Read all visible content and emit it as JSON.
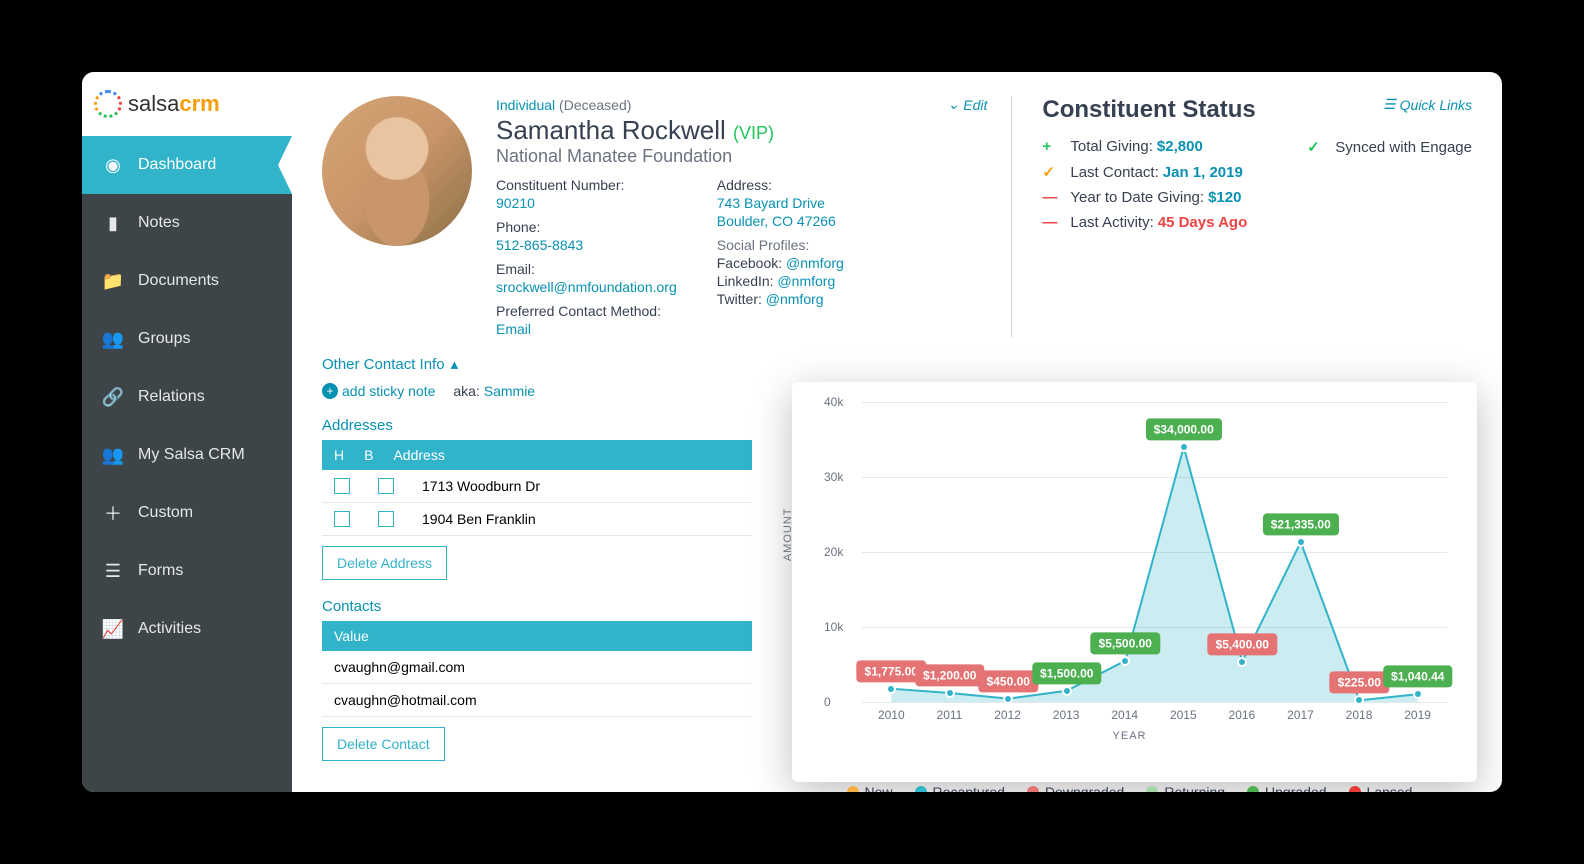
{
  "logo": {
    "brand_a": "salsa",
    "brand_b": "crm"
  },
  "nav": [
    {
      "label": "Dashboard",
      "icon": "dashboard",
      "active": true
    },
    {
      "label": "Notes",
      "icon": "notes"
    },
    {
      "label": "Documents",
      "icon": "folder"
    },
    {
      "label": "Groups",
      "icon": "group"
    },
    {
      "label": "Relations",
      "icon": "link"
    },
    {
      "label": "My Salsa CRM",
      "icon": "group"
    },
    {
      "label": "Custom",
      "icon": "plus"
    },
    {
      "label": "Forms",
      "icon": "form"
    },
    {
      "label": "Activities",
      "icon": "chart"
    }
  ],
  "profile": {
    "type": "Individual",
    "status": "(Deceased)",
    "edit": "Edit",
    "name": "Samantha Rockwell",
    "vip": "(VIP)",
    "org": "National Manatee Foundation",
    "constituent_lbl": "Constituent Number:",
    "constituent": "90210",
    "phone_lbl": "Phone:",
    "phone": "512-865-8843",
    "email_lbl": "Email:",
    "email": "srockwell@nmfoundation.org",
    "pref_lbl": "Preferred Contact Method:",
    "pref": "Email",
    "address_lbl": "Address:",
    "address_1": "743 Bayard Drive",
    "address_2": "Boulder, CO 47266",
    "social_lbl": "Social Profiles:",
    "fb_lbl": "Facebook:",
    "fb": "@nmforg",
    "li_lbl": "LinkedIn:",
    "li": "@nmforg",
    "tw_lbl": "Twitter:",
    "tw": "@nmforg"
  },
  "status": {
    "title": "Constituent Status",
    "total_giving_lbl": "Total Giving:",
    "total_giving": "$2,800",
    "last_contact_lbl": "Last Contact:",
    "last_contact": "Jan 1, 2019",
    "ytd_lbl": "Year to Date Giving:",
    "ytd": "$120",
    "last_activity_lbl": "Last Activity:",
    "last_activity": "45 Days Ago",
    "synced": "Synced with Engage"
  },
  "quick_links": "Quick Links",
  "other_contact": "Other Contact Info",
  "add_sticky": "add sticky note",
  "aka_lbl": "aka:",
  "aka_val": "Sammie",
  "addresses": {
    "title": "Addresses",
    "headers": {
      "h": "H",
      "b": "B",
      "addr": "Address"
    },
    "rows": [
      "1713 Woodburn Dr",
      "1904 Ben Franklin"
    ],
    "delete": "Delete Address"
  },
  "contacts": {
    "title": "Contacts",
    "header": "Value",
    "rows": [
      "cvaughn@gmail.com",
      "cvaughn@hotmail.com"
    ],
    "delete": "Delete Contact"
  },
  "chart_data": {
    "type": "line",
    "ylabel": "AMOUNT",
    "xlabel": "YEAR",
    "yticks": [
      0,
      "10k",
      "20k",
      "30k",
      "40k"
    ],
    "ylim": [
      0,
      40000
    ],
    "categories": [
      2010,
      2011,
      2012,
      2013,
      2014,
      2015,
      2016,
      2017,
      2018,
      2019
    ],
    "values": [
      1775,
      1200,
      450,
      1500,
      5500,
      34000,
      5400,
      21335,
      225,
      1040.44
    ],
    "labels": [
      "$1,775.00",
      "$1,200.00",
      "$450.00",
      "$1,500.00",
      "$5,500.00",
      "$34,000.00",
      "$5,400.00",
      "$21,335.00",
      "$225.00",
      "$1,040.44"
    ],
    "label_colors": [
      "red",
      "red",
      "red",
      "green",
      "green",
      "green",
      "red",
      "green",
      "red",
      "green"
    ],
    "legend": [
      {
        "name": "New",
        "color": "#f5b041"
      },
      {
        "name": "Recaptured",
        "color": "#31b3c9"
      },
      {
        "name": "Downgraded",
        "color": "#e57373"
      },
      {
        "name": "Returning",
        "color": "#a5d6a7"
      },
      {
        "name": "Upgraded",
        "color": "#4caf50"
      },
      {
        "name": "Lapsed",
        "color": "#e53935"
      }
    ]
  }
}
